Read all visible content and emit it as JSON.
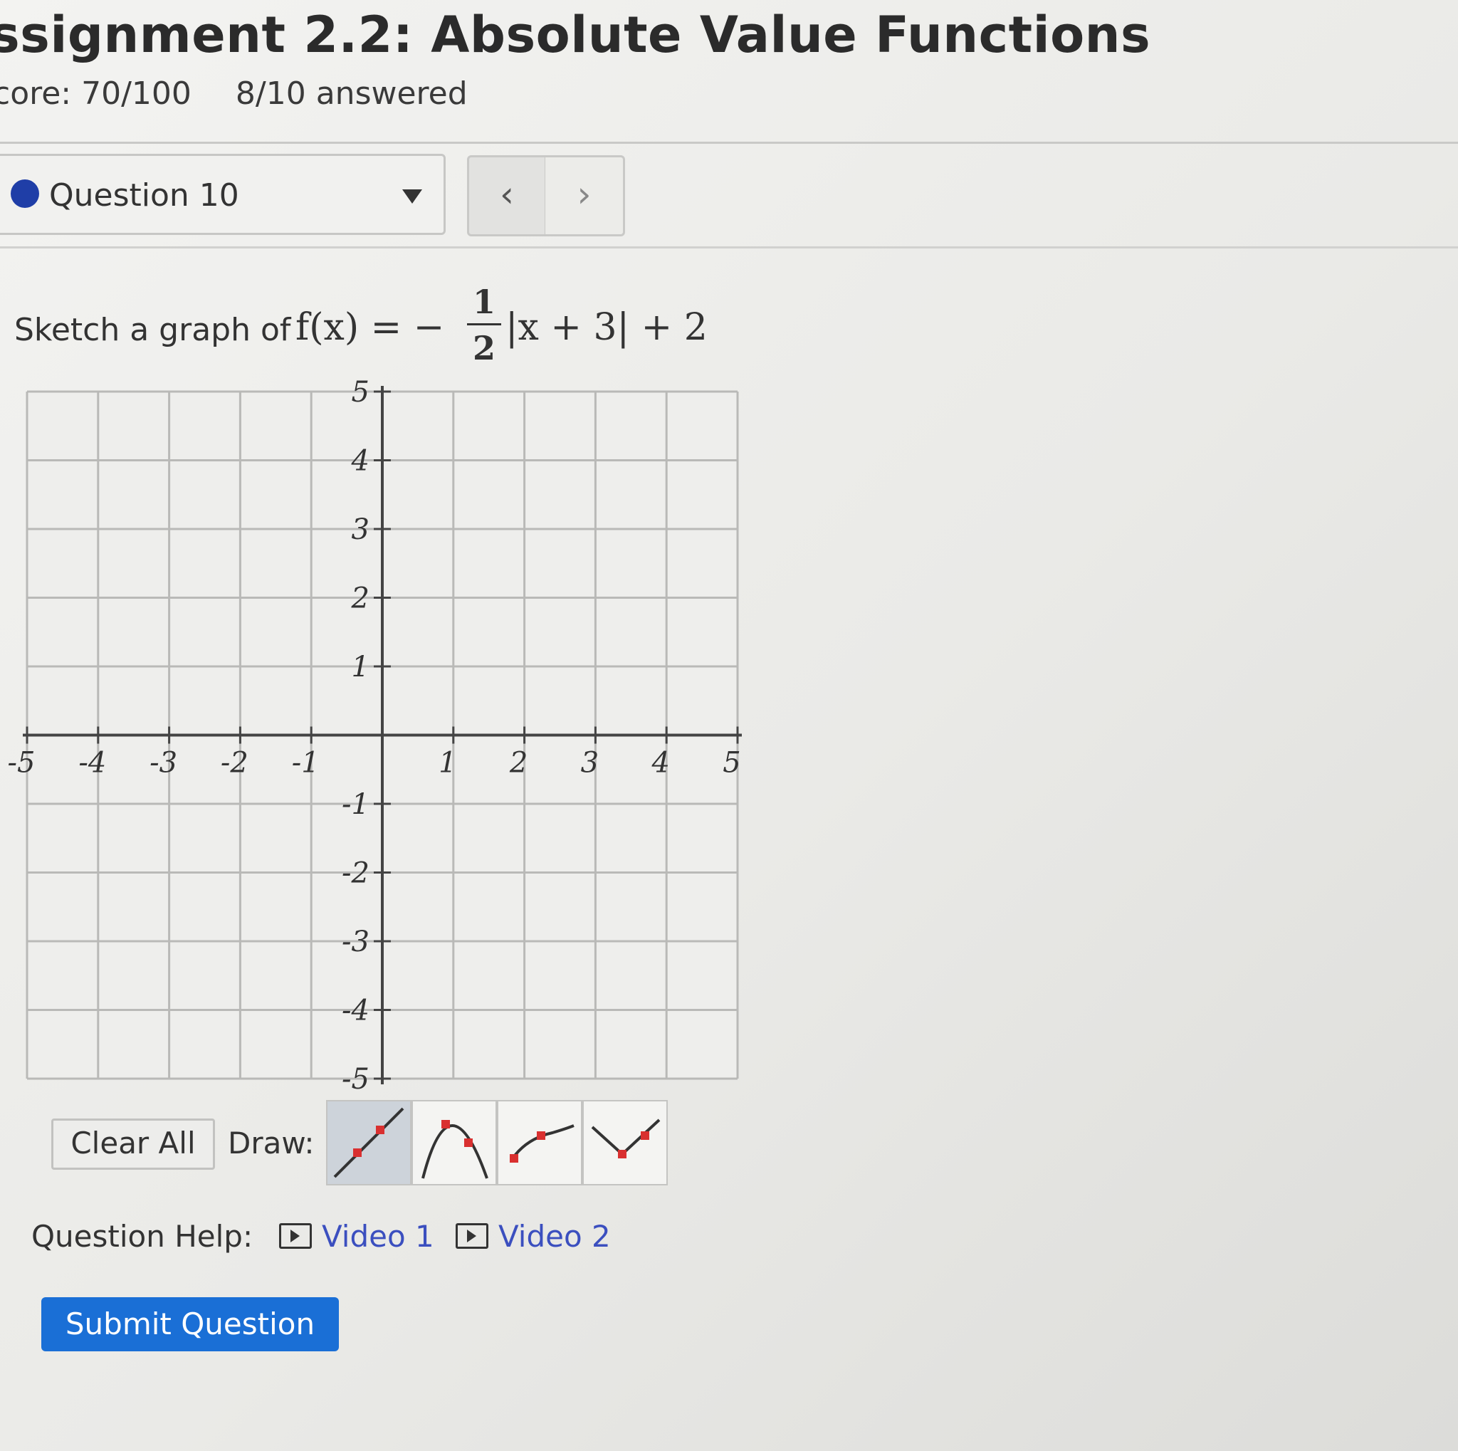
{
  "header": {
    "title": "ssignment 2.2: Absolute Value Functions",
    "score": "core: 70/100",
    "answered": "8/10 answered"
  },
  "question_nav": {
    "selected": "Question 10",
    "prev_icon": "chevron-left-icon",
    "next_icon": "chevron-right-icon"
  },
  "prompt": {
    "lead": "Sketch a graph of",
    "func": "f(x) = −",
    "frac_num": "1",
    "frac_den": "2",
    "rest": "|x + 3| + 2"
  },
  "graph": {
    "x_range": [
      -5,
      5
    ],
    "y_range": [
      -5,
      5
    ],
    "x_tick_labels": [
      "-5",
      "-4",
      "-3",
      "-2",
      "-1",
      "1",
      "2",
      "3",
      "4",
      "5"
    ],
    "y_tick_labels": [
      "5",
      "4",
      "3",
      "2",
      "1",
      "-1",
      "-2",
      "-3",
      "-4",
      "-5"
    ],
    "grid": true
  },
  "toolbar": {
    "clear_label": "Clear All",
    "draw_label": "Draw:",
    "tools": [
      {
        "name": "line-tool-icon",
        "active": true
      },
      {
        "name": "parabola-tool-icon",
        "active": false
      },
      {
        "name": "curve-tool-icon",
        "active": false
      },
      {
        "name": "absolute-value-tool-icon",
        "active": false
      }
    ]
  },
  "help": {
    "label": "Question Help:",
    "video1": "Video 1",
    "video2": "Video 2"
  },
  "submit_label": "Submit Question",
  "colors": {
    "accent": "#1a6fd6",
    "dot": "#1f3ea7",
    "link": "#3b4fbf",
    "tool_point": "#d93030"
  }
}
